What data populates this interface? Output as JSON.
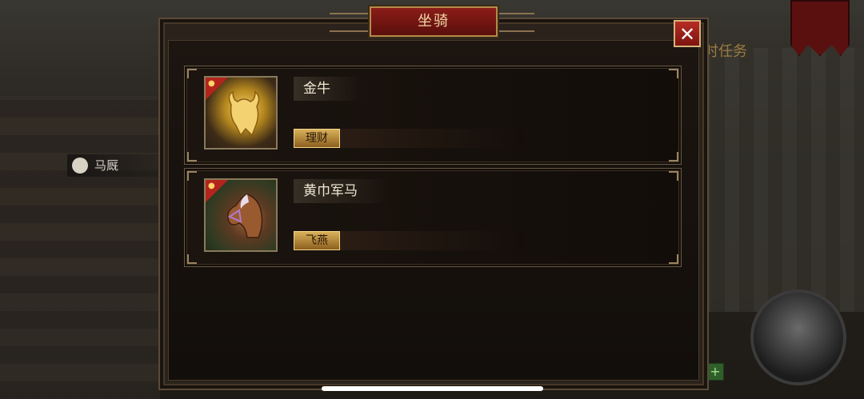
{
  "window": {
    "title": "坐骑",
    "close_label": "✕"
  },
  "background": {
    "stable_label": "马厩",
    "task_text": "时任务",
    "plus_label": "+"
  },
  "mounts": [
    {
      "name": "金牛",
      "skill_label": "理财",
      "portrait": "gold-ox-icon"
    },
    {
      "name": "黄巾军马",
      "skill_label": "飞燕",
      "portrait": "war-horse-icon"
    }
  ],
  "colors": {
    "title_plate": "#8b1c18",
    "close_button": "#b62c24",
    "skill_button": "#d9b15a",
    "owned_ribbon": "#b3241c"
  }
}
